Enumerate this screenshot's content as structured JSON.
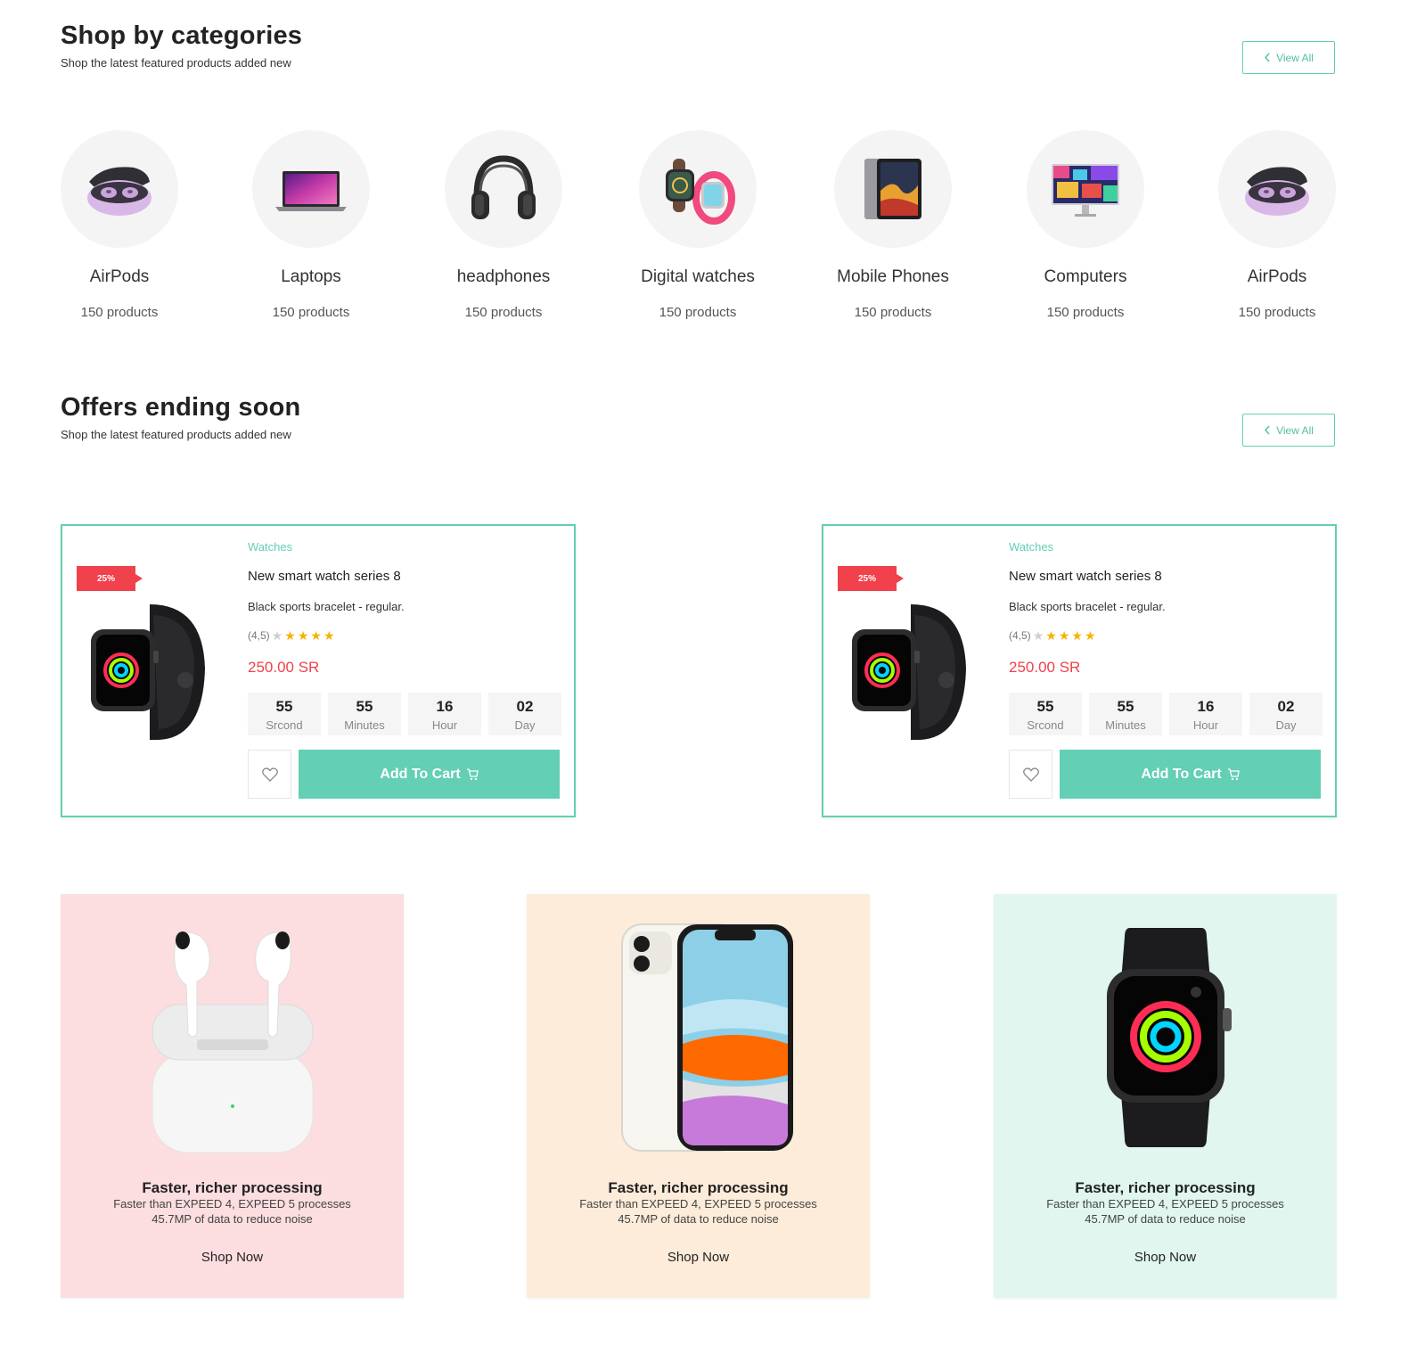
{
  "categories_section": {
    "title": "Shop by categories",
    "subtitle": "Shop the latest featured products added new",
    "view_all": "View All",
    "items": [
      {
        "name": "AirPods",
        "count": "150 products",
        "icon": "airpods-case-icon"
      },
      {
        "name": "Laptops",
        "count": "150 products",
        "icon": "laptop-icon"
      },
      {
        "name": "headphones",
        "count": "150 products",
        "icon": "headphones-icon"
      },
      {
        "name": "Digital watches",
        "count": "150 products",
        "icon": "smartwatch-icon"
      },
      {
        "name": "Mobile Phones",
        "count": "150 products",
        "icon": "tablet-icon"
      },
      {
        "name": "Computers",
        "count": "150 products",
        "icon": "monitor-icon"
      },
      {
        "name": "AirPods",
        "count": "150 products",
        "icon": "airpods-case-icon"
      }
    ]
  },
  "offers_section": {
    "title": "Offers ending soon",
    "subtitle": "Shop the latest featured products added new",
    "view_all": "View All",
    "cards": [
      {
        "badge": "25%",
        "category": "Watches",
        "name": "New smart watch series 8",
        "description": "Black sports bracelet - regular.",
        "rating": "(4,5)",
        "price": "250.00 SR",
        "countdown": [
          {
            "value": "55",
            "label": "Srcond"
          },
          {
            "value": "55",
            "label": "Minutes"
          },
          {
            "value": "16",
            "label": "Hour"
          },
          {
            "value": "02",
            "label": "Day"
          }
        ],
        "cart_label": "Add To Cart"
      },
      {
        "badge": "25%",
        "category": "Watches",
        "name": "New smart watch series 8",
        "description": "Black sports bracelet - regular.",
        "rating": "(4,5)",
        "price": "250.00 SR",
        "countdown": [
          {
            "value": "55",
            "label": "Srcond"
          },
          {
            "value": "55",
            "label": "Minutes"
          },
          {
            "value": "16",
            "label": "Hour"
          },
          {
            "value": "02",
            "label": "Day"
          }
        ],
        "cart_label": "Add To Cart"
      }
    ]
  },
  "promos": [
    {
      "title": "Faster, richer processing",
      "line1": "Faster than EXPEED 4, EXPEED 5 processes",
      "line2": "45.7MP of data to reduce noise",
      "cta": "Shop Now",
      "bg": "#fcdde0",
      "image": "airpods-icon"
    },
    {
      "title": "Faster, richer processing",
      "line1": "Faster than EXPEED 4, EXPEED 5 processes",
      "line2": "45.7MP of data to reduce noise",
      "cta": "Shop Now",
      "bg": "#fdecd9",
      "image": "iphone-icon"
    },
    {
      "title": "Faster, richer processing",
      "line1": "Faster than EXPEED 4, EXPEED 5 processes",
      "line2": "45.7MP of data to reduce noise",
      "cta": "Shop Now",
      "bg": "#e0f6ef",
      "image": "apple-watch-icon"
    }
  ],
  "colors": {
    "accent": "#63cfb4",
    "price": "#f0414c",
    "star": "#f5b301"
  }
}
